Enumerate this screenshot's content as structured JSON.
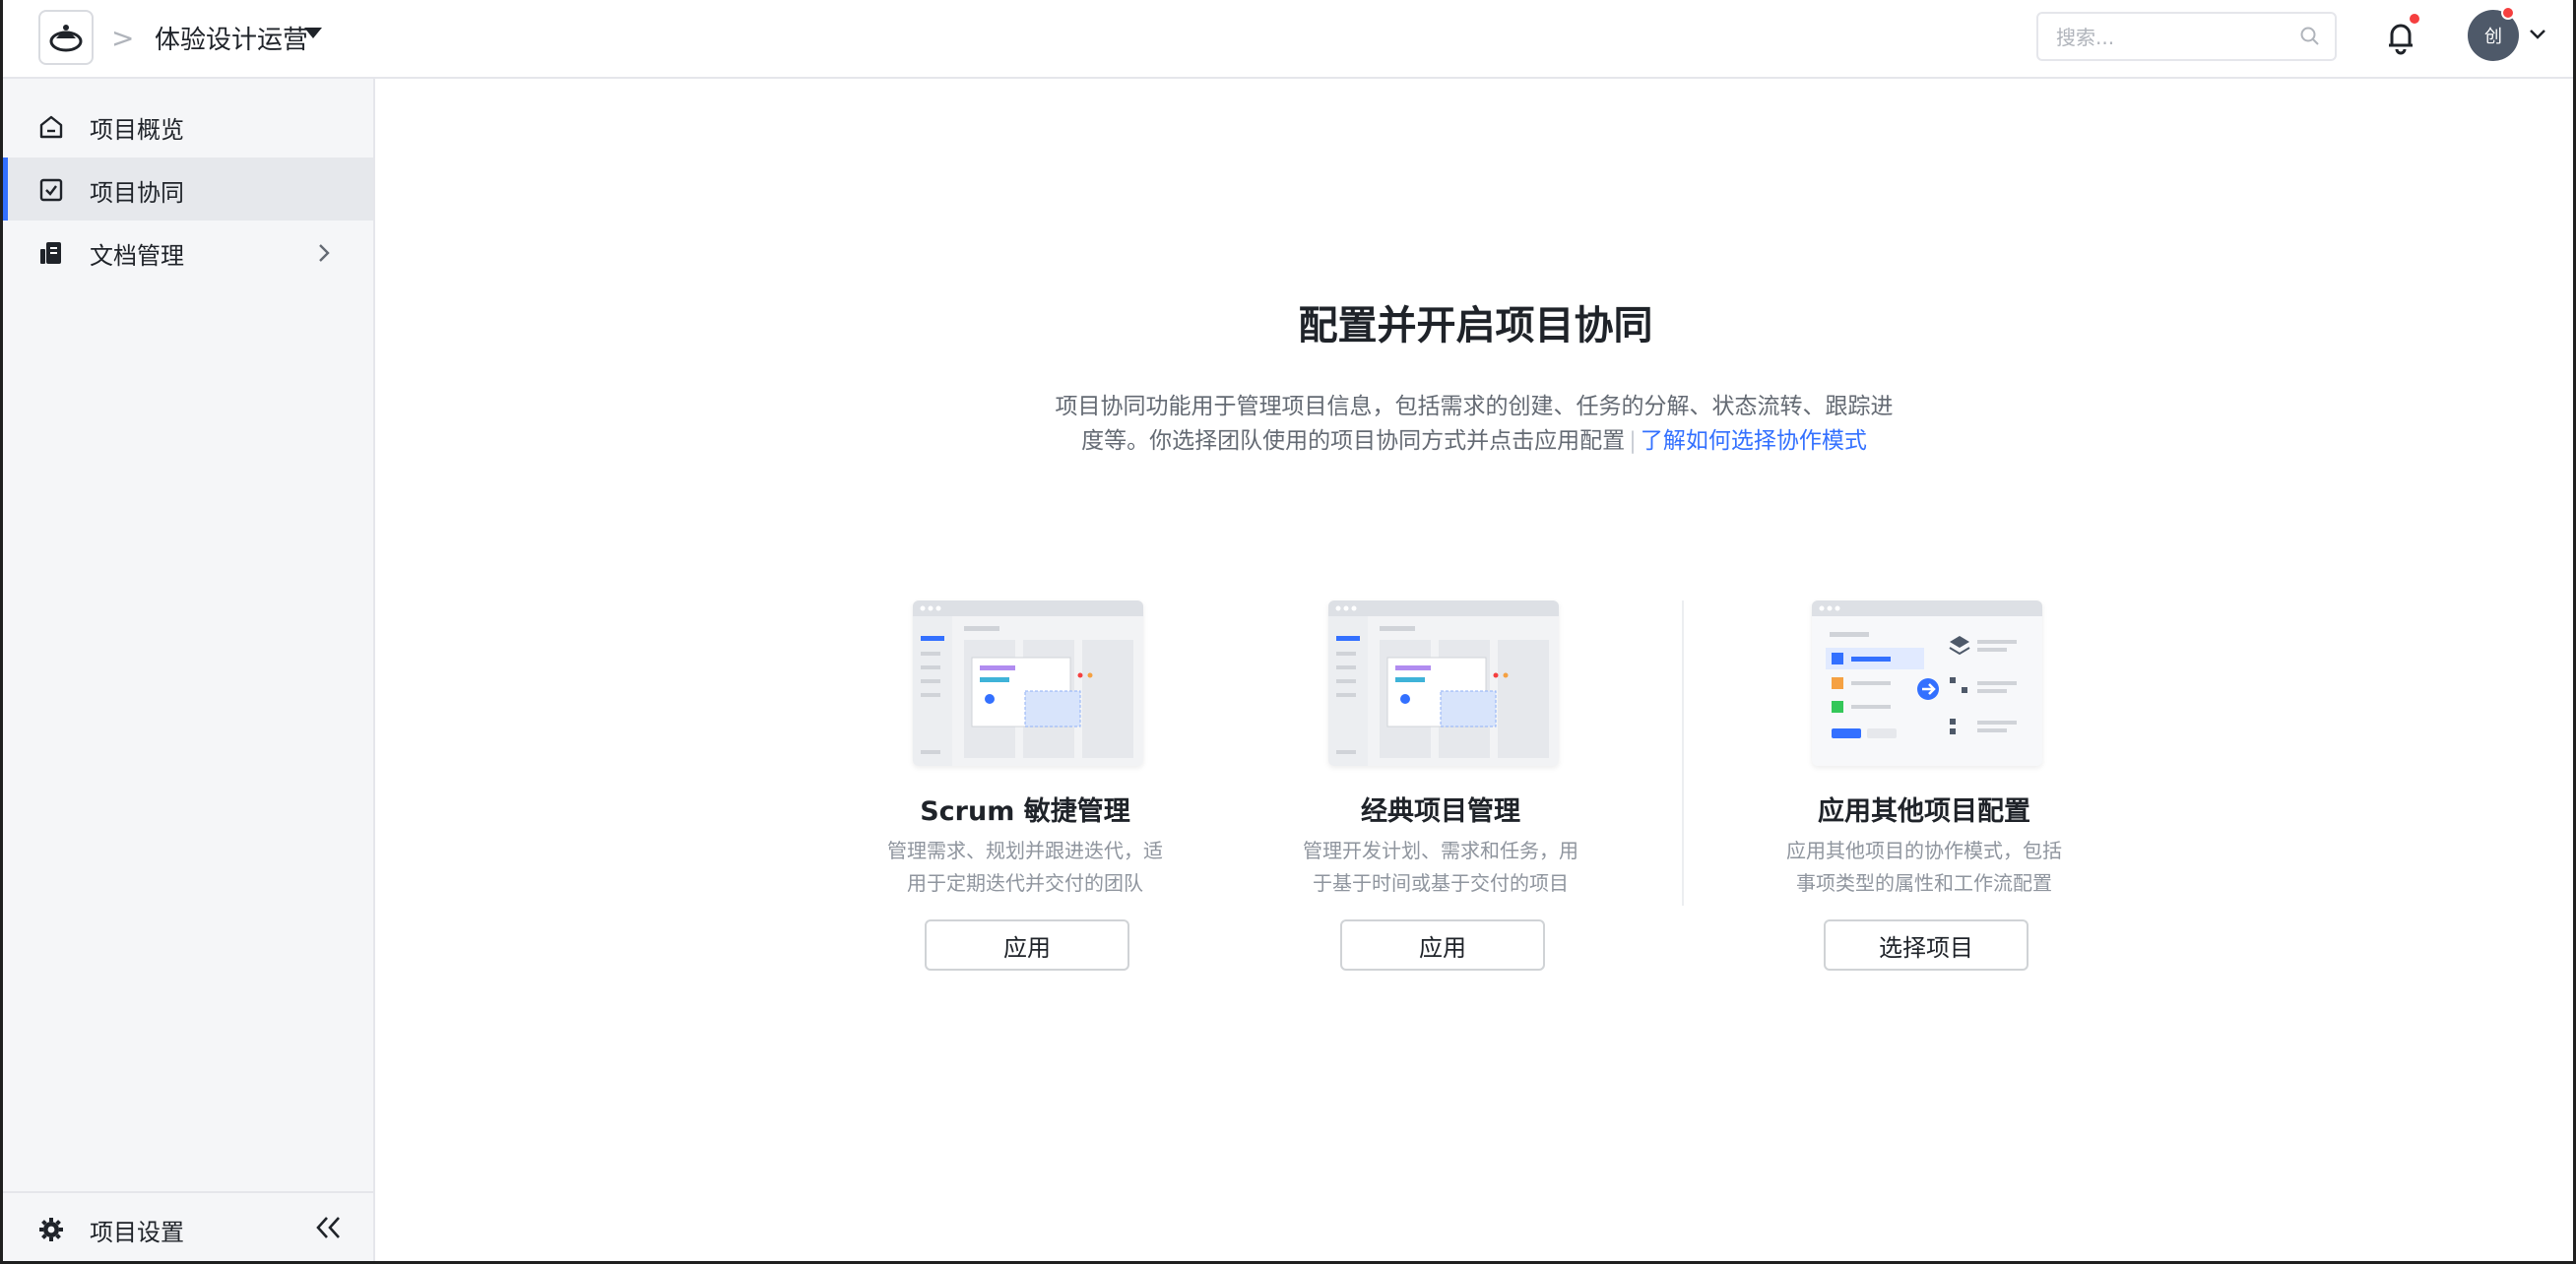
{
  "header": {
    "project_name": "体验设计运营",
    "breadcrumb_separator": ">",
    "search_placeholder": "搜索...",
    "avatar_text": "创"
  },
  "sidebar": {
    "items": [
      {
        "label": "项目概览",
        "icon": "home-icon"
      },
      {
        "label": "项目协同",
        "icon": "checkbox-icon",
        "active": true
      },
      {
        "label": "文档管理",
        "icon": "document-icon",
        "has_children": true
      }
    ],
    "footer_label": "项目设置"
  },
  "main": {
    "title": "配置并开启项目协同",
    "description_line1": "项目协同功能用于管理项目信息，包括需求的创建、任务的分解、状态流转、跟踪进",
    "description_line2": "度等。你选择团队使用的项目协同方式并点击应用配置",
    "learn_link": "了解如何选择协作模式",
    "cards": [
      {
        "title": "Scrum 敏捷管理",
        "desc_line1": "管理需求、规划并跟进迭代，适",
        "desc_line2": "用于定期迭代并交付的团队",
        "button": "应用"
      },
      {
        "title": "经典项目管理",
        "desc_line1": "管理开发计划、需求和任务，用",
        "desc_line2": "于基于时间或基于交付的项目",
        "button": "应用"
      },
      {
        "title": "应用其他项目配置",
        "desc_line1": "应用其他项目的协作模式，包括",
        "desc_line2": "事项类型的属性和工作流配置",
        "button": "选择项目"
      }
    ]
  },
  "colors": {
    "accent": "#3370ff",
    "notification_dot": "#f53f3f",
    "sidebar_bg": "#f5f6f8",
    "active_bg": "#e6e8ec"
  }
}
